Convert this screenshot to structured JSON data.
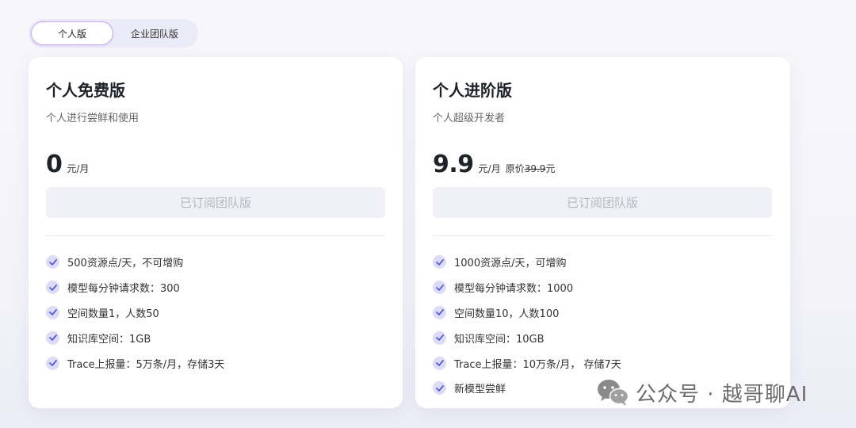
{
  "tabs": [
    {
      "label": "个人版",
      "active": true
    },
    {
      "label": "企业团队版",
      "active": false
    }
  ],
  "plans": [
    {
      "title": "个人免费版",
      "subtitle": "个人进行尝鲜和使用",
      "price": "0",
      "unit": "元/月",
      "subscribe_label": "已订阅团队版",
      "features": [
        "500资源点/天，不可增购",
        "模型每分钟请求数：300",
        "空间数量1，人数50",
        "知识库空间：1GB",
        "Trace上报量：5万条/月，存储3天"
      ]
    },
    {
      "title": "个人进阶版",
      "subtitle": "个人超级开发者",
      "price": "9.9",
      "unit": "元/月",
      "original_label": "原价",
      "original_price": "39.9",
      "original_suffix": "元",
      "subscribe_label": "已订阅团队版",
      "features": [
        "1000资源点/天，可增购",
        "模型每分钟请求数：1000",
        "空间数量10，人数100",
        "知识库空间：10GB",
        "Trace上报量：10万条/月， 存储7天",
        "新模型尝鲜"
      ]
    }
  ],
  "watermark": {
    "text": "公众号 · 越哥聊AI",
    "icon": "wechat-icon"
  },
  "colors": {
    "check_bg": "#dcdcf6",
    "check_mark": "#5b5bd6",
    "tab_active_border": "#c7a7e8"
  }
}
